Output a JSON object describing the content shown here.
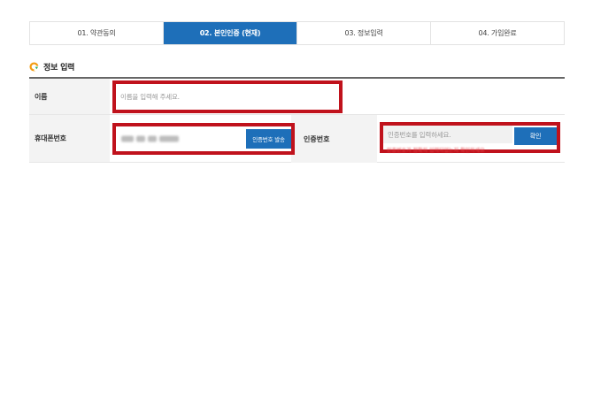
{
  "steps": [
    {
      "label": "01. 약관동의",
      "active": false
    },
    {
      "label": "02. 본인인증 (현재)",
      "active": true
    },
    {
      "label": "03. 정보입력",
      "active": false
    },
    {
      "label": "04. 가입완료",
      "active": false
    }
  ],
  "section": {
    "title": "정보 입력",
    "icon": "circle-arrow-icon"
  },
  "form": {
    "name": {
      "label": "이름",
      "placeholder": "이름을 입력해 주세요."
    },
    "phone": {
      "label": "휴대폰번호",
      "value": "",
      "send_button": "인증번호 발송"
    },
    "code": {
      "label": "인증번호",
      "placeholder": "인증번호를 입력하세요.",
      "confirm_button": "확인",
      "hint": "인증번호가 정확히 입력되었는지 확인하세요"
    }
  },
  "colors": {
    "accent": "#1e6fb9",
    "highlight": "#c0121c",
    "warning": "#e6484c"
  }
}
